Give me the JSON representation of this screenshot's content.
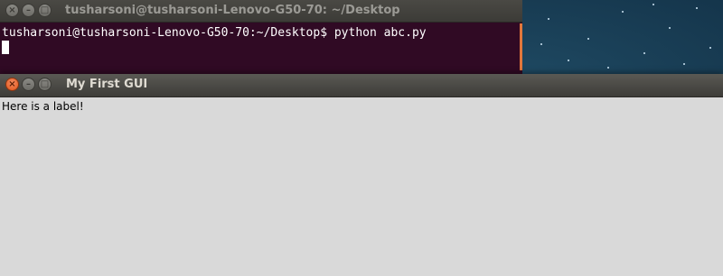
{
  "terminal": {
    "title": "tusharsoni@tusharsoni-Lenovo-G50-70: ~/Desktop",
    "prompt": "tusharsoni@tusharsoni-Lenovo-G50-70:~/Desktop$",
    "command": "python abc.py",
    "colors": {
      "background": "#300a24",
      "text": "#ffffff"
    }
  },
  "gui_window": {
    "title": "My First GUI",
    "label": "Here is a label!",
    "colors": {
      "background": "#d9d9d9",
      "close_button": "#e0561b"
    }
  },
  "window_controls": {
    "close_icon": "×",
    "minimize_icon": "–",
    "maximize_icon": "□"
  }
}
